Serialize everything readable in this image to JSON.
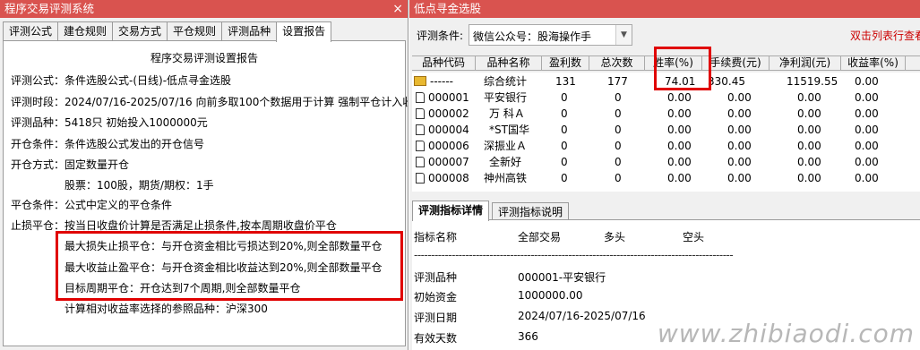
{
  "left_window": {
    "title": "程序交易评测系统",
    "close_glyph": "×",
    "tabs": [
      "评测公式",
      "建仓规则",
      "交易方式",
      "平仓规则",
      "评测品种",
      "设置报告"
    ],
    "active_tab": "设置报告",
    "report": {
      "title": "程序交易评测设置报告",
      "lines": [
        "评测公式：条件选股公式-(日线)-低点寻金选股",
        "评测时段：2024/07/16-2025/07/16 向前多取100个数据用于计算 强制平仓计入收益",
        "评测品种：5418只 初始投入1000000元",
        "开仓条件：条件选股公式发出的开仓信号",
        "开仓方式：固定数量开仓",
        "股票：100股，期货/期权：1手",
        "平仓条件：公式中定义的平仓条件",
        "止损平仓：按当日收盘价计算是否满足止损条件,按本周期收盘价平仓",
        "最大损失止损平仓：与开仓资金相比亏损达到20%,则全部数量平仓",
        "最大收益止盈平仓：与开仓资金相比收益达到20%,则全部数量平仓",
        "目标周期平仓：开仓达到7个周期,则全部数量平仓",
        "计算相对收益率选择的参照品种：沪深300"
      ]
    }
  },
  "right_window": {
    "title": "低点寻金选股",
    "criteria_label": "评测条件:",
    "criteria_value": "微信公众号：股海操作手",
    "hint": "双击列表行查看",
    "columns": [
      "品种代码",
      "品种名称",
      "盈利数",
      "总次数",
      "胜率(%)",
      "手续费(元)",
      "净利润(元)",
      "收益率(%)"
    ],
    "rows": [
      {
        "code": "------",
        "name": "综合统计",
        "wins": "131",
        "total": "177",
        "win_rate": "74.01",
        "fee": "330.45",
        "profit": "11519.55",
        "ret": "0.00"
      },
      {
        "code": "000001",
        "name": "平安银行",
        "wins": "0",
        "total": "0",
        "win_rate": "0.00",
        "fee": "0.00",
        "profit": "0.00",
        "ret": "0.00"
      },
      {
        "code": "000002",
        "name": "万 科Ａ",
        "wins": "0",
        "total": "0",
        "win_rate": "0.00",
        "fee": "0.00",
        "profit": "0.00",
        "ret": "0.00"
      },
      {
        "code": "000004",
        "name": "*ST国华",
        "wins": "0",
        "total": "0",
        "win_rate": "0.00",
        "fee": "0.00",
        "profit": "0.00",
        "ret": "0.00"
      },
      {
        "code": "000006",
        "name": "深振业Ａ",
        "wins": "0",
        "total": "0",
        "win_rate": "0.00",
        "fee": "0.00",
        "profit": "0.00",
        "ret": "0.00"
      },
      {
        "code": "000007",
        "name": "全新好",
        "wins": "0",
        "total": "0",
        "win_rate": "0.00",
        "fee": "0.00",
        "profit": "0.00",
        "ret": "0.00"
      },
      {
        "code": "000008",
        "name": "神州高铁",
        "wins": "0",
        "total": "0",
        "win_rate": "0.00",
        "fee": "0.00",
        "profit": "0.00",
        "ret": "0.00"
      }
    ],
    "detail_tabs": [
      "评测指标详情",
      "评测指标说明"
    ],
    "detail": {
      "headers": [
        "指标名称",
        "全部交易",
        "多头",
        "空头"
      ],
      "separator": "---------------------------------------------------------------------------------------------",
      "items": [
        {
          "label": "评测品种",
          "value": "000001-平安银行"
        },
        {
          "label": "初始资金",
          "value": "1000000.00"
        },
        {
          "label": "评测日期",
          "value": "2024/07/16-2025/07/16"
        },
        {
          "label": "有效天数",
          "value": "366"
        }
      ]
    },
    "watermark": "www.zhibiaodi.com"
  },
  "colors": {
    "title_bar": "#d9534f",
    "highlight": "#e00000",
    "hint": "#cc0000"
  }
}
